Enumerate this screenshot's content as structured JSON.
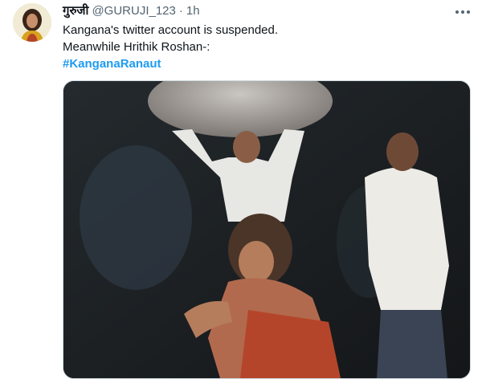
{
  "tweet": {
    "display_name": "गुरुजी",
    "handle": "@GURUJI_123",
    "separator": "·",
    "time": "1h",
    "lines": [
      "Kangana's twitter account is suspended.",
      "Meanwhile Hrithik Roshan-:"
    ],
    "hashtag": "#KanganaRanaut"
  },
  "icons": {
    "more": "more-horizontal-icon",
    "avatar": "profile-avatar"
  },
  "colors": {
    "link": "#1d9bf0",
    "secondary_text": "#536471",
    "border": "#cfd9de"
  }
}
